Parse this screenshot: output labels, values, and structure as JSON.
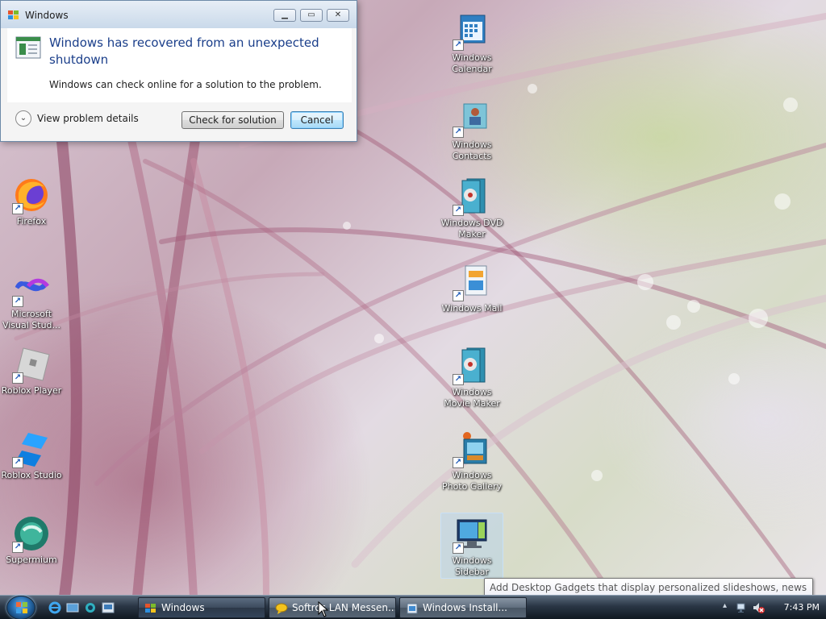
{
  "dialog": {
    "title": "Windows",
    "heading": "Windows has recovered from an unexpected shutdown",
    "message": "Windows can check online for a solution to the problem.",
    "details_label": "View problem details",
    "check_button": "Check for solution",
    "cancel_button": "Cancel"
  },
  "desktop_icons_left": [
    {
      "label": "Firefox",
      "icon": "firefox-icon"
    },
    {
      "label": "Microsoft Visual Stud...",
      "icon": "visual-studio-icon"
    },
    {
      "label": "Roblox Player",
      "icon": "roblox-player-icon"
    },
    {
      "label": "Roblox Studio",
      "icon": "roblox-studio-icon"
    },
    {
      "label": "Supermium",
      "icon": "supermium-icon"
    }
  ],
  "desktop_icons_right": [
    {
      "label": "Windows Calendar",
      "icon": "calendar-icon"
    },
    {
      "label": "Windows Contacts",
      "icon": "contacts-icon"
    },
    {
      "label": "Windows DVD Maker",
      "icon": "dvd-maker-icon"
    },
    {
      "label": "Windows Mail",
      "icon": "mail-icon"
    },
    {
      "label": "Windows Movie Maker",
      "icon": "movie-maker-icon"
    },
    {
      "label": "Windows Photo Gallery",
      "icon": "photo-gallery-icon"
    },
    {
      "label": "Windows Sidebar",
      "icon": "sidebar-icon"
    }
  ],
  "taskbar": {
    "tasks": [
      {
        "label": "Windows",
        "icon": "windows-flag-icon"
      },
      {
        "label": "Softros LAN Messen...",
        "icon": "messenger-icon"
      },
      {
        "label": "Windows Install...",
        "icon": "installer-icon"
      }
    ],
    "clock": "7:43 PM"
  },
  "tooltip": {
    "text": "Add Desktop Gadgets that display personalized slideshows, news feeds, and other customized information."
  },
  "colors": {
    "dialog_heading": "#1a3e8a",
    "taskbar": "#2a3645",
    "desktop_label": "#ffffff"
  }
}
